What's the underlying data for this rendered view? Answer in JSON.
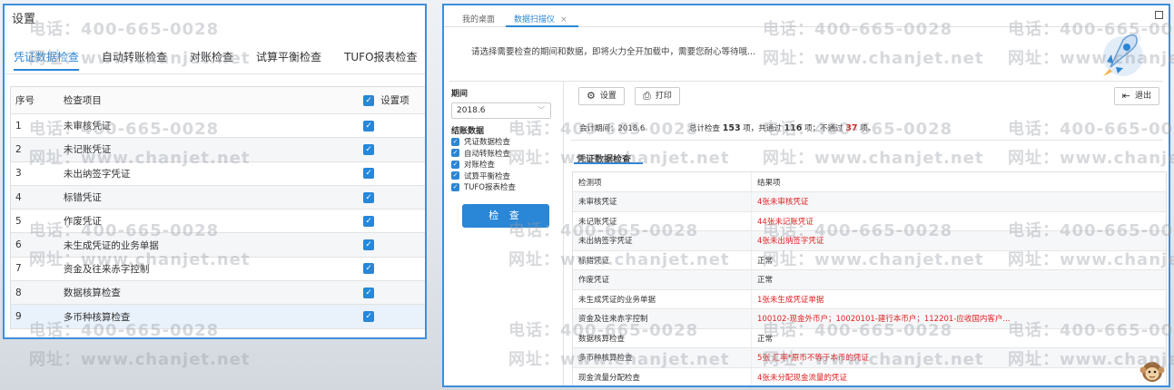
{
  "left": {
    "title": "设置",
    "tabs": [
      "凭证数据检查",
      "自动转账检查",
      "对账检查",
      "试算平衡检查",
      "TUFO报表检查"
    ],
    "table_head": {
      "no": "序号",
      "item": "检查项目",
      "setting": "设置项"
    },
    "rows": [
      {
        "no": "1",
        "item": "未审核凭证"
      },
      {
        "no": "2",
        "item": "未记账凭证"
      },
      {
        "no": "3",
        "item": "未出纳签字凭证"
      },
      {
        "no": "4",
        "item": "标错凭证"
      },
      {
        "no": "5",
        "item": "作废凭证"
      },
      {
        "no": "6",
        "item": "未生成凭证的业务单据"
      },
      {
        "no": "7",
        "item": "资金及往来赤字控制"
      },
      {
        "no": "8",
        "item": "数据核算检查"
      },
      {
        "no": "9",
        "item": "多币种核算检查"
      }
    ]
  },
  "right": {
    "tabs": [
      {
        "label": "我的桌面"
      },
      {
        "label": "数据扫描仪"
      }
    ],
    "tab_close": "×",
    "banner": "请选择需要检查的期间和数据，即将火力全开加载中，需要您耐心等待哦...",
    "period_label": "期间",
    "period_value": "2018.6",
    "group_label": "结账数据",
    "options": [
      "凭证数据检查",
      "自动转账检查",
      "对账检查",
      "试算平衡检查",
      "TUFO报表检查"
    ],
    "check_button": "检 查",
    "settings_button": "设置",
    "print_button": "打印",
    "exit_button": "退出",
    "summary": {
      "period": "会计期间：2018.6",
      "prefix": "总计检查",
      "total": "153",
      "mid1": "项，共通过",
      "passed": "116",
      "mid2": "项；不通过",
      "failed": "37",
      "suffix": "项。"
    },
    "section_title": "凭证数据检查",
    "table_head": {
      "item": "检测项",
      "result": "结果项"
    },
    "rows": [
      {
        "item": "未审核凭证",
        "result": "4张未审核凭证",
        "status": "fail"
      },
      {
        "item": "未记账凭证",
        "result": "44张未记账凭证",
        "status": "fail"
      },
      {
        "item": "未出纳签字凭证",
        "result": "4张未出纳签字凭证",
        "status": "fail"
      },
      {
        "item": "标错凭证",
        "result": "正常",
        "status": "ok"
      },
      {
        "item": "作废凭证",
        "result": "正常",
        "status": "ok"
      },
      {
        "item": "未生成凭证的业务单据",
        "result": "1张未生成凭证单据",
        "status": "fail"
      },
      {
        "item": "资金及往来赤字控制",
        "result": "100102-现金外币户；10020101-建行本币户；112201-应收国内客户...",
        "status": "fail"
      },
      {
        "item": "数据核算检查",
        "result": "正常",
        "status": "ok"
      },
      {
        "item": "多币种核算检查",
        "result": "5张 汇率*原币不等于本币的凭证",
        "status": "fail"
      },
      {
        "item": "现金流量分配检查",
        "result": "4张未分配现金流量的凭证",
        "status": "fail"
      }
    ]
  },
  "watermark": {
    "phone": "电话：400-665-0028",
    "site": "网址：www.chanjet.net"
  },
  "colors": {
    "accent": "#2a86d6",
    "fail": "#e02020",
    "frame": "#3d8fdc"
  },
  "icons": {
    "settings": "gear-icon",
    "print": "printer-icon",
    "exit": "exit-icon",
    "check": "checkmark-icon",
    "maximize": "maximize-icon"
  }
}
